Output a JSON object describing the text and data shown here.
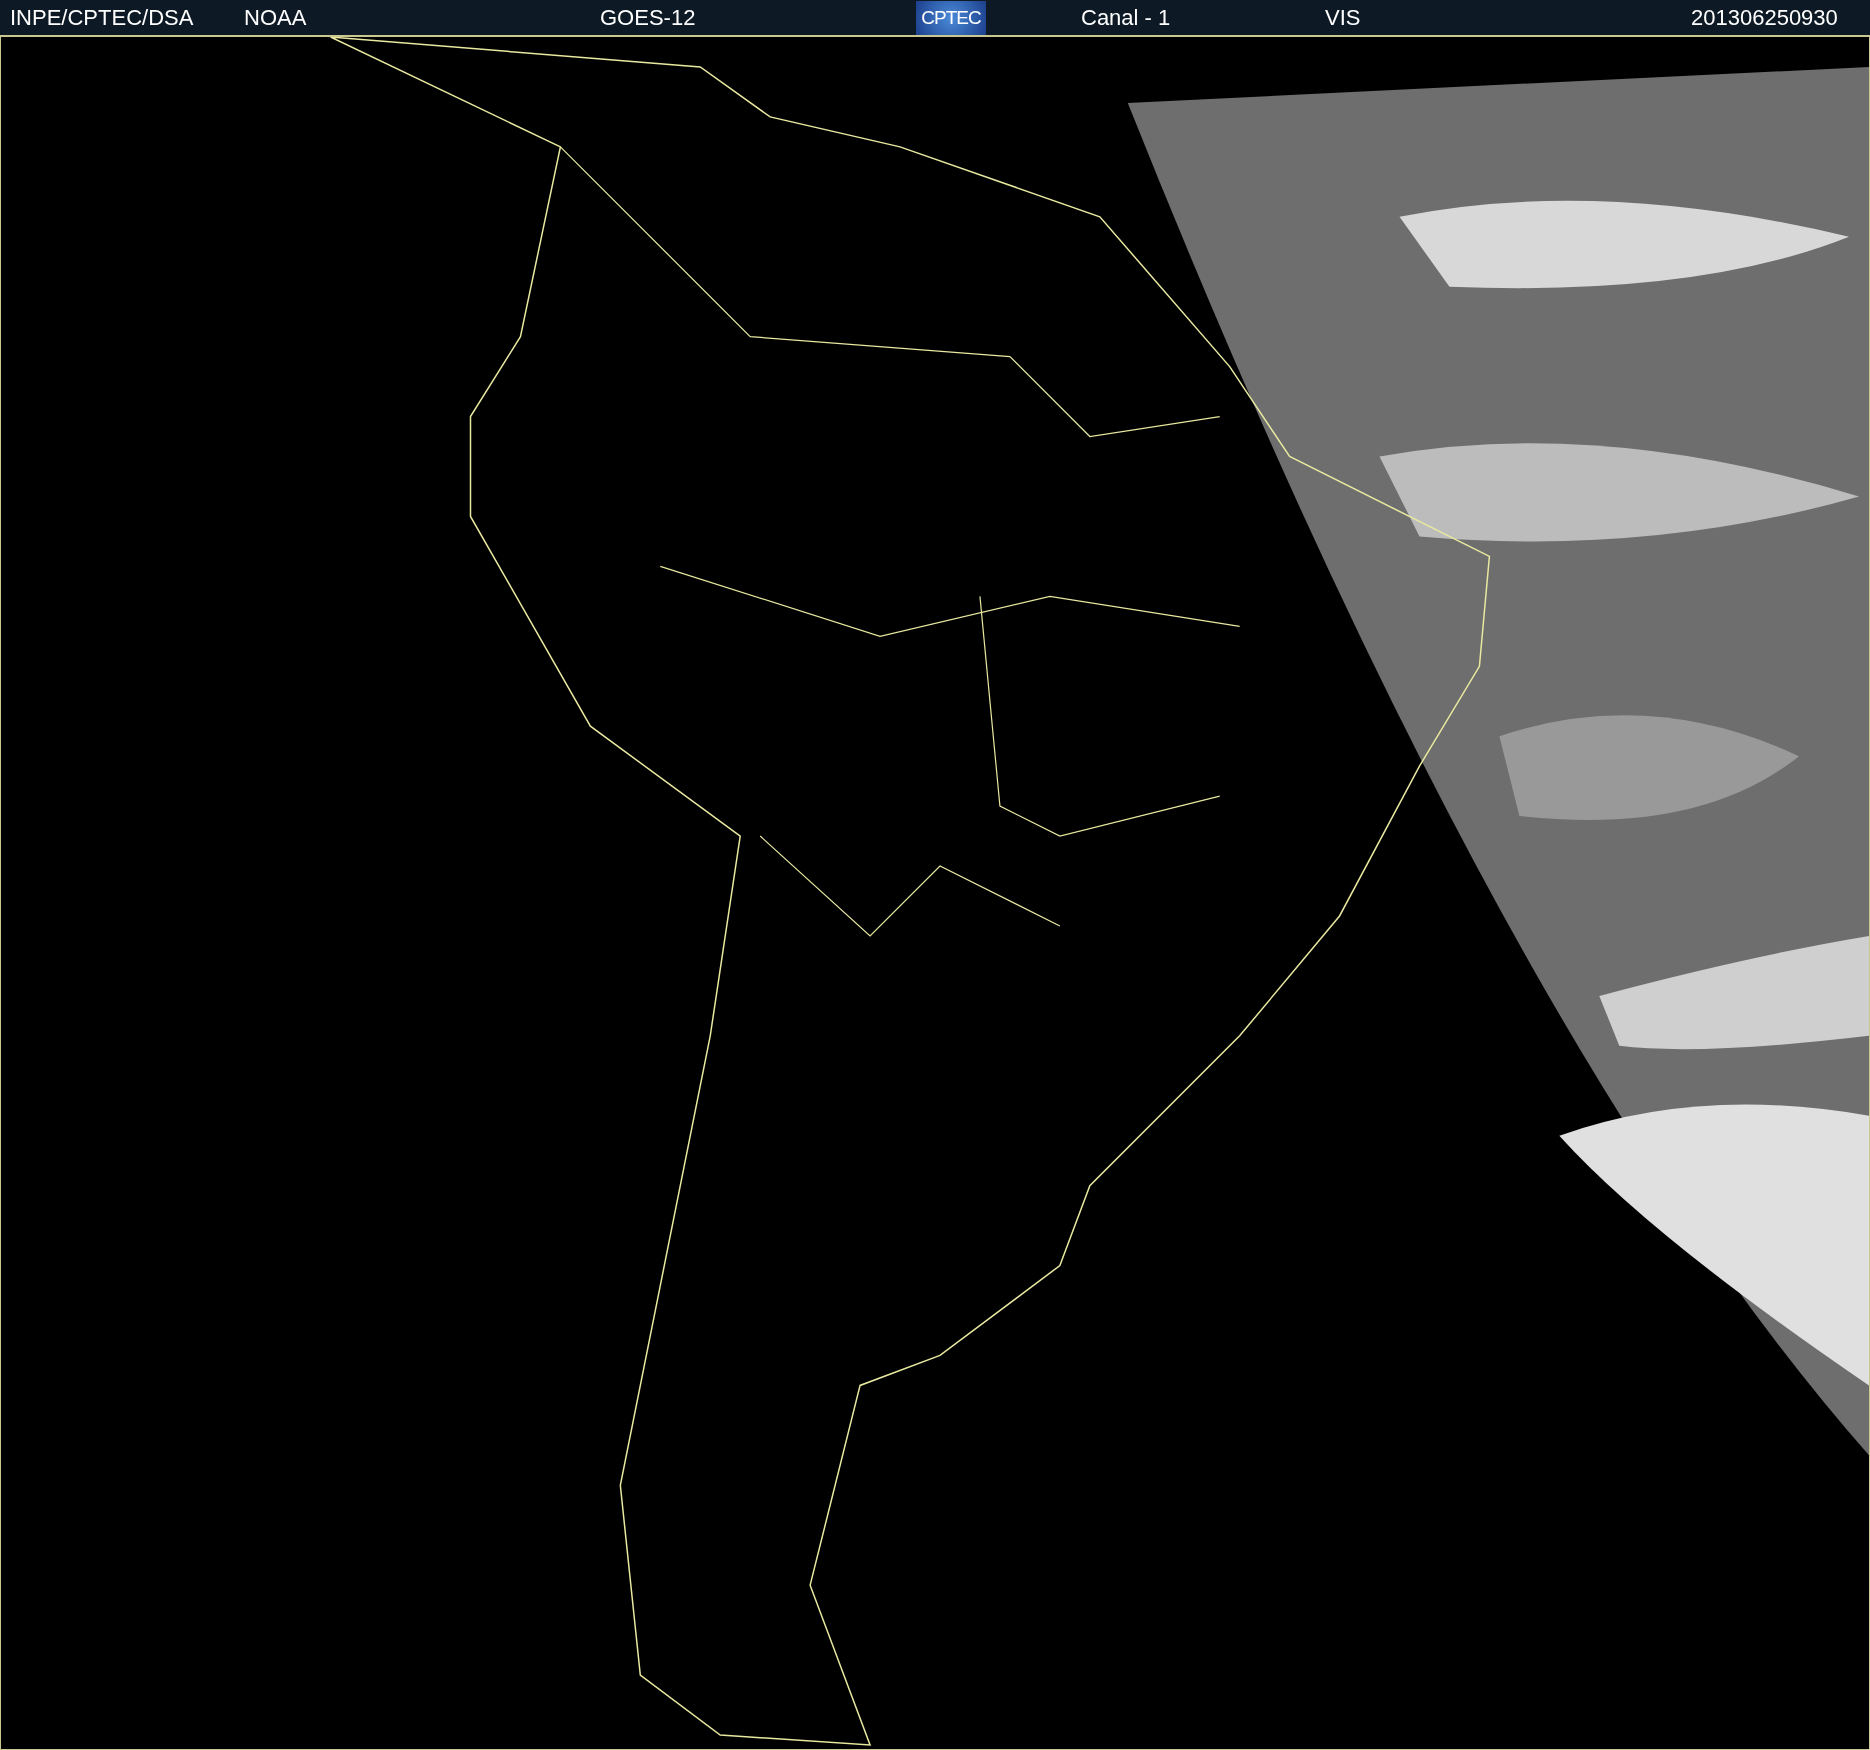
{
  "header": {
    "source": "INPE/CPTEC/DSA",
    "agency": "NOAA",
    "satellite": "GOES-12",
    "logo_text": "CPTEC",
    "channel": "Canal - 1",
    "band": "VIS",
    "timestamp": "201306250930"
  }
}
